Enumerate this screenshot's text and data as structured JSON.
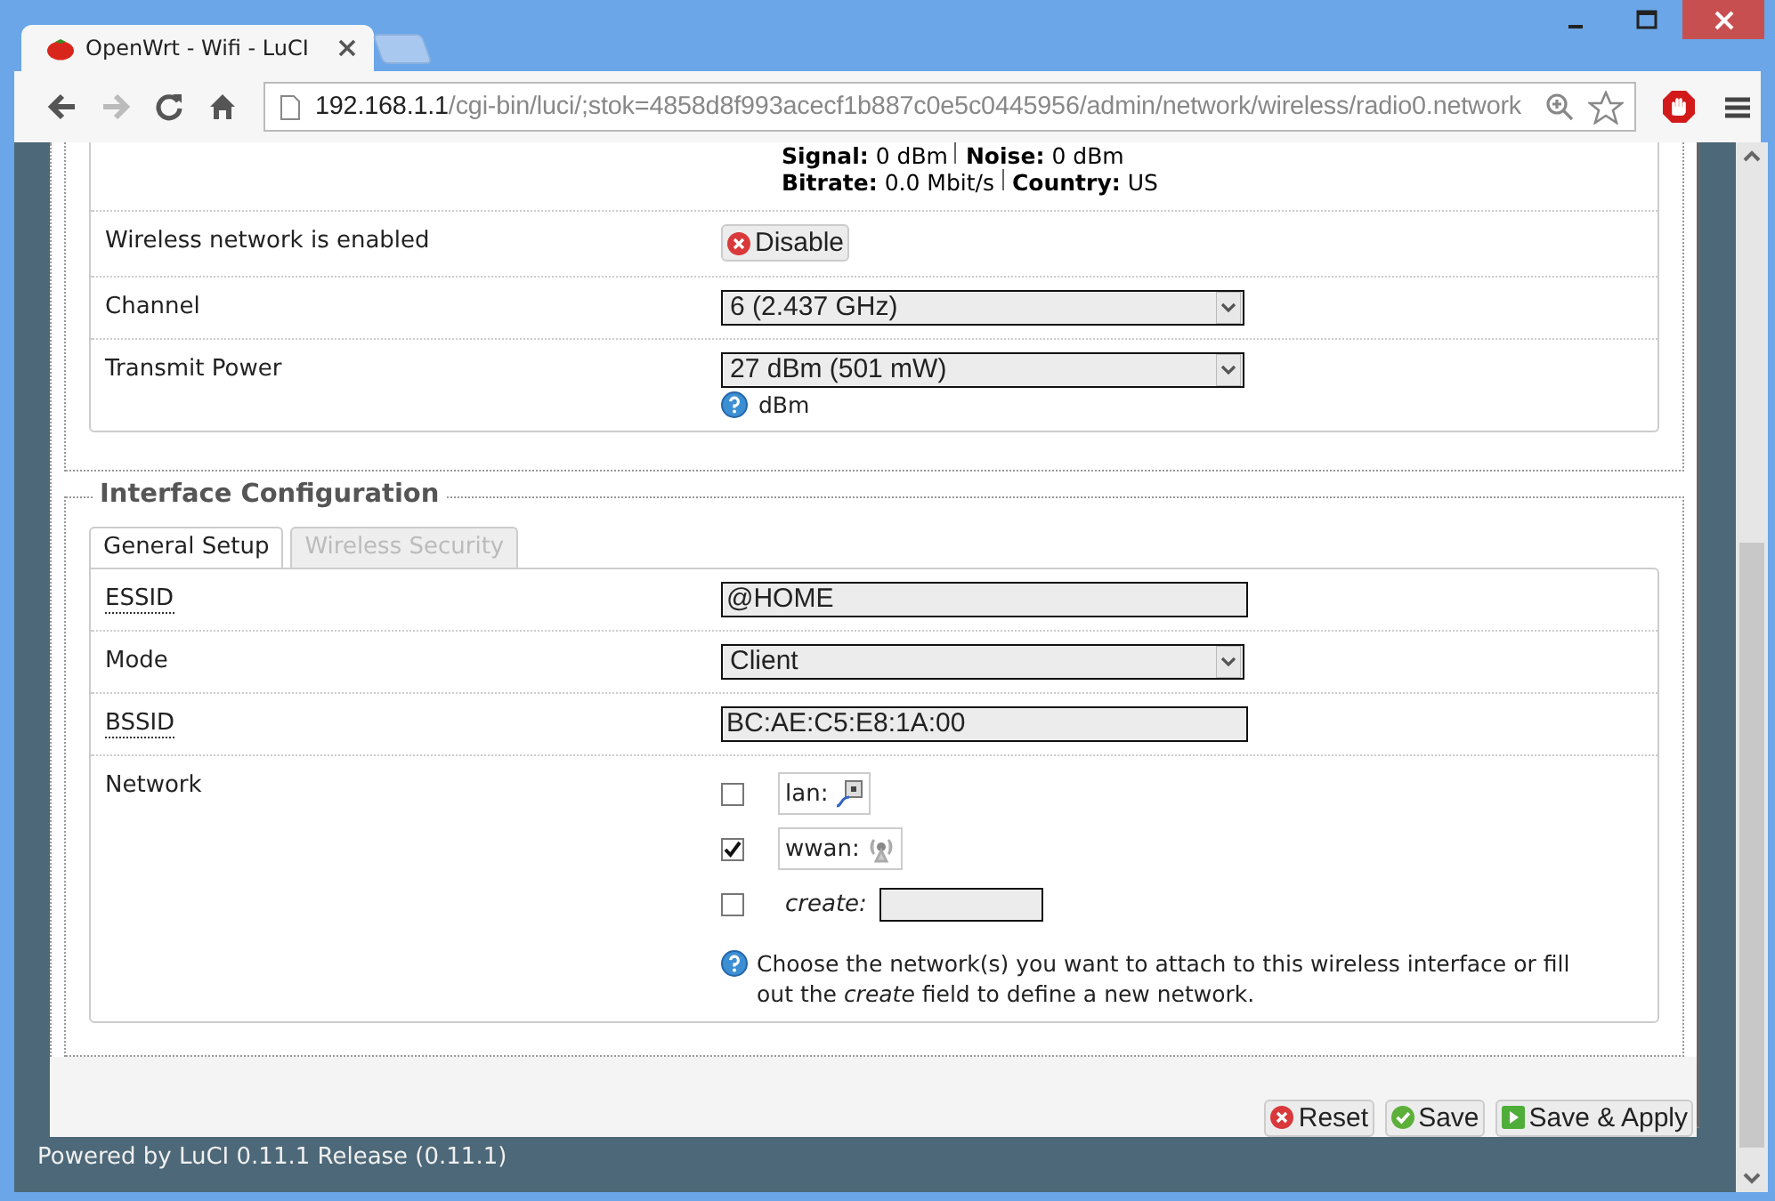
{
  "window": {
    "tab_title": "OpenWrt - Wifi - LuCI",
    "address_host": "192.168.1.1",
    "address_path": "/cgi-bin/luci/;stok=4858d8f993acecf1b887c0e5c0445956/admin/network/wireless/radio0.network"
  },
  "status": {
    "lines": [
      [
        {
          "label": "Signal:",
          "value": "0 dBm"
        },
        {
          "label": "Noise:",
          "value": "0 dBm"
        }
      ],
      [
        {
          "label": "Bitrate:",
          "value": "0.0 Mbit/s"
        },
        {
          "label": "Country:",
          "value": "US"
        }
      ]
    ]
  },
  "device_rows": [
    {
      "label": "Wireless network is enabled",
      "kind": "button",
      "value": "Disable"
    },
    {
      "label": "Channel",
      "kind": "select",
      "value": "6 (2.437 GHz)"
    },
    {
      "label": "Transmit Power",
      "kind": "select",
      "value": "27 dBm (501 mW)",
      "hint": "dBm"
    }
  ],
  "interface": {
    "legend": "Interface Configuration",
    "tabs": [
      {
        "label": "General Setup",
        "selected": true
      },
      {
        "label": "Wireless Security",
        "selected": false
      }
    ],
    "rows": [
      {
        "label": "ESSID",
        "kind": "text",
        "value": "@HOME",
        "abbr": true
      },
      {
        "label": "Mode",
        "kind": "select",
        "value": "Client",
        "abbr": false
      },
      {
        "label": "BSSID",
        "kind": "text",
        "value": "BC:AE:C5:E8:1A:00",
        "abbr": true
      },
      {
        "label": "Network",
        "kind": "networks",
        "abbr": false,
        "options": [
          {
            "kind": "lan",
            "name": "lan:",
            "checked": false
          },
          {
            "kind": "wifi",
            "name": "wwan:",
            "checked": true
          },
          {
            "kind": "create",
            "name": "create:",
            "checked": false
          }
        ],
        "hint": "Choose the network(s) you want to attach to this wireless interface or fill out the *create* field to define a new network."
      }
    ]
  },
  "actions": [
    {
      "label": "Reset",
      "kind": "reset"
    },
    {
      "label": "Save",
      "kind": "save"
    },
    {
      "label": "Save & Apply",
      "kind": "apply"
    }
  ],
  "footer": "Powered by LuCI 0.11.1 Release (0.11.1)"
}
